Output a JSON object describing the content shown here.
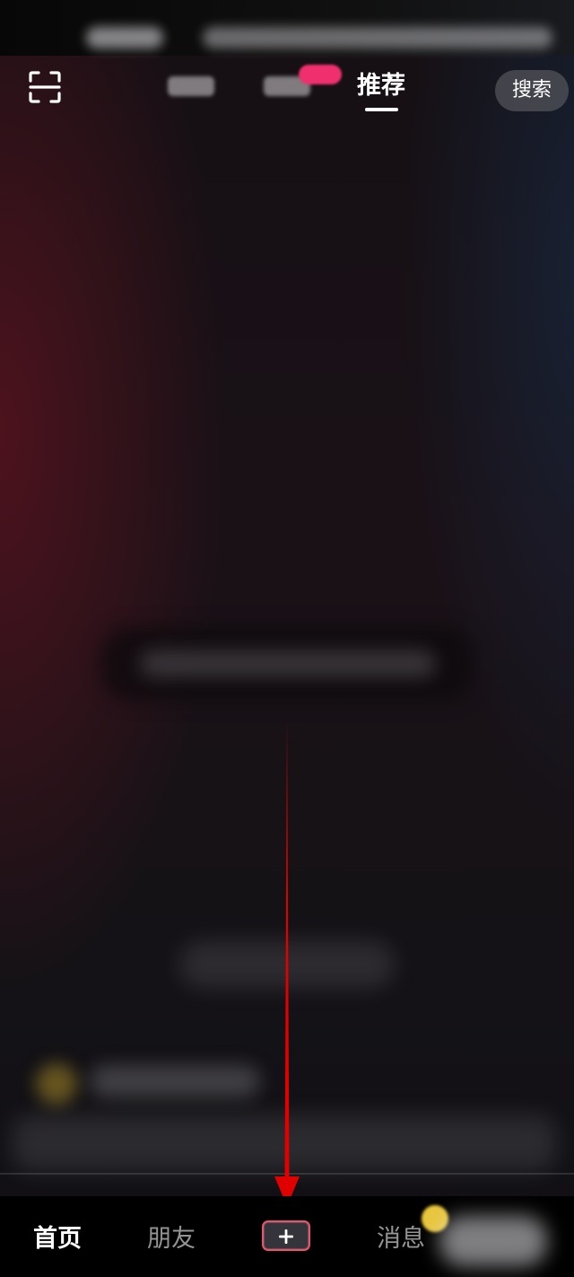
{
  "header": {
    "tabs": {
      "recommend": "推荐"
    },
    "search_label": "搜索"
  },
  "bottom_nav": {
    "home": "首页",
    "friends": "朋友",
    "messages": "消息"
  },
  "icons": {
    "scan": "scan-icon",
    "create": "plus-icon"
  },
  "colors": {
    "annotation_arrow": "#e00000",
    "live_badge": "#f0306e",
    "create_button_border": "#f0506a",
    "notification_dot": "#e8c63c"
  }
}
